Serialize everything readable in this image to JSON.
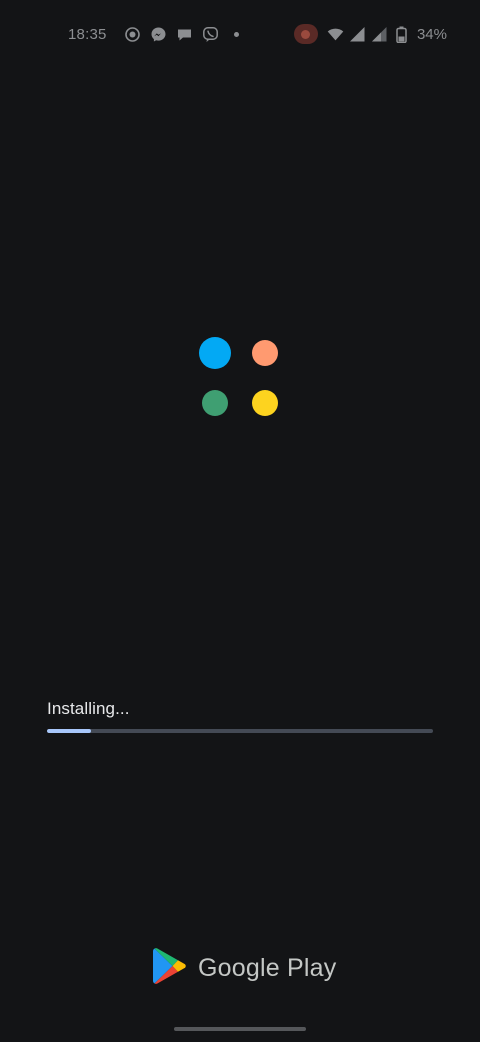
{
  "status_bar": {
    "time": "18:35",
    "battery_percent": "34%",
    "left_icons": [
      "screen-record-icon",
      "messenger-icon",
      "chat-bubble-icon",
      "viber-icon",
      "notification-dot-icon"
    ],
    "right_icons": [
      "recording-indicator-icon",
      "wifi-icon",
      "signal-icon",
      "signal-icon",
      "battery-icon"
    ]
  },
  "loader": {
    "colors": {
      "blue": "#03a9f4",
      "orange": "#ff9a70",
      "green": "#3f9f72",
      "yellow": "#fdd31f"
    }
  },
  "install": {
    "label": "Installing...",
    "progress": 0.115,
    "track_color": "#444a55",
    "fill_color": "#a8c7fa"
  },
  "brand": {
    "name": "Google Play",
    "logo_icon": "google-play-logo-icon"
  }
}
